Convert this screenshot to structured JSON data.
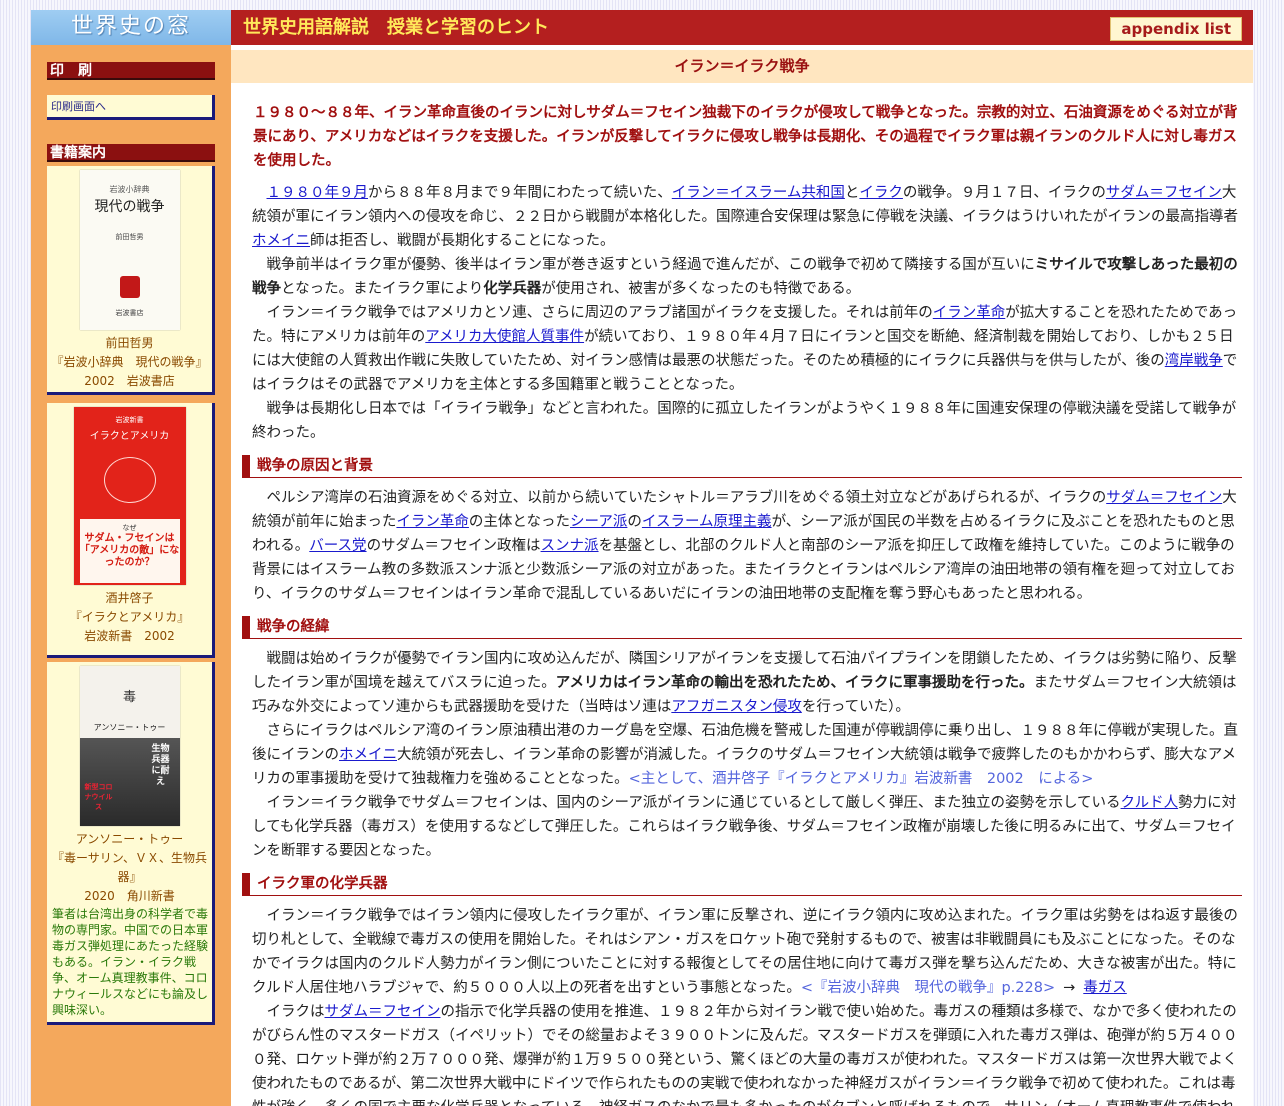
{
  "header": {
    "site_logo": "世界史の窓",
    "section_title": "世界史用語解説　授業と学習のヒント",
    "appendix_label": "appendix list"
  },
  "sidebar": {
    "print_heading": "印　刷",
    "print_link": "印刷画面へ",
    "books_heading": "書籍案内",
    "books": [
      {
        "cover_series": "岩波小辞典",
        "cover_title": "現代の戦争",
        "cover_author": "前田哲男",
        "cover_publisher": "岩波書店",
        "author": "前田哲男",
        "title": "『岩波小辞典　現代の戦争』",
        "pub": "2002　岩波書店"
      },
      {
        "cover_series": "岩波新書",
        "cover_title": "イラクとアメリカ",
        "cover_band_1": "なぜ",
        "cover_band_2": "サダム・フセインは「アメリカの敵」になったのか？",
        "author": "酒井啓子",
        "title": "『イラクとアメリカ』",
        "pub": "岩波新書　2002"
      },
      {
        "cover_title": "毒",
        "cover_author": "アンソニー・トゥー",
        "cover_big": "生物兵器に耐え",
        "cover_red": "新型コロナウイルス",
        "author": "アンソニー・トゥー",
        "title": "『毒ーサリン、ＶＸ、生物兵器』",
        "pub": "2020　角川新書",
        "desc": "筆者は台湾出身の科学者で毒物の専門家。中国での日本軍毒ガス弾処理にあたった経験もある。イラン・イラク戦争、オーム真理教事件、コロナウィールスなどにも論及し興味深い。"
      }
    ]
  },
  "main": {
    "term": "イラン＝イラク戦争",
    "lead": "１９８０～８８年、イラン革命直後のイランに対しサダム＝フセイン独裁下のイラクが侵攻して戦争となった。宗教的対立、石油資源をめぐる対立が背景にあり、アメリカなどはイラクを支援した。イランが反撃してイラクに侵攻し戦争は長期化、その過程でイラク軍は親イランのクルド人に対し毒ガスを使用した。",
    "p1": {
      "link_year": "１９８０年９月",
      "t1": "から８８年８月まで９年間にわたって続いた、",
      "link_iran": "イラン＝イスラーム共和国",
      "t2": "と",
      "link_iraq": "イラク",
      "t3": "の戦争。９月１７日、イラクの",
      "link_saddam": "サダム＝フセイン",
      "t4": "大統領が軍にイラン領内への侵攻を命じ、２２日から戦闘が本格化した。国際連合安保理は緊急に停戦を決議、イラクはうけいれたがイランの最高指導者",
      "link_khomeini": "ホメイニ",
      "t5": "師は拒否し、戦闘が長期化することになった。"
    },
    "p2": {
      "t1": "戦争前半はイラク軍が優勢、後半はイラン軍が巻き返すという経過で進んだが、この戦争で初めて隣接する国が互いに",
      "b1": "ミサイルで攻撃しあった最初の戦争",
      "t2": "となった。またイラク軍により",
      "b2": "化学兵器",
      "t3": "が使用され、被害が多くなったのも特徴である。"
    },
    "p3": {
      "t1": "イラン＝イラク戦争ではアメリカとソ連、さらに周辺のアラブ諸国がイラクを支援した。それは前年の",
      "link_rev": "イラン革命",
      "t2": "が拡大することを恐れたためであった。特にアメリカは前年の",
      "link_hostage": "アメリカ大使館人質事件",
      "t3": "が続いており、１９８０年４月７日にイランと国交を断絶、経済制裁を開始しており、しかも２５日には大使館の人質救出作戦に失敗していたため、対イラン感情は最悪の状態だった。そのため積極的にイラクに兵器供与を供与したが、後の",
      "link_gulf": "湾岸戦争",
      "t4": "ではイラクはその武器でアメリカを主体とする多国籍軍と戦うこととなった。"
    },
    "p4": "戦争は長期化し日本では「イライラ戦争」などと言われた。国際的に孤立したイランがようやく１９８８年に国連安保理の停戦決議を受諾して戦争が終わった。",
    "h_cause": "戦争の原因と背景",
    "p5": {
      "t1": "ペルシア湾岸の石油資源をめぐる対立、以前から続いていたシャトル＝アラブ川をめぐる領土対立などがあげられるが、イラクの",
      "link_saddam": "サダム＝フセイン",
      "t2": "大統領が前年に始まった",
      "link_rev": "イラン革命",
      "t3": "の主体となった",
      "link_shia": "シーア派",
      "t4": "の",
      "link_fund": "イスラーム原理主義",
      "t5": "が、シーア派が国民の半数を占めるイラクに及ぶことを恐れたものと思われる。",
      "link_baath": "バース党",
      "t6": "のサダム＝フセイン政権は",
      "link_sunni": "スンナ派",
      "t7": "を基盤とし、北部のクルド人と南部のシーア派を抑圧して政権を維持していた。このように戦争の背景にはイスラーム教の多数派スンナ派と少数派シーア派の対立があった。またイラクとイランはペルシア湾岸の油田地帯の領有権を廻って対立しており、イラクのサダム＝フセインはイラン革命で混乱しているあいだにイランの油田地帯の支配権を奪う野心もあったと思われる。"
    },
    "h_course": "戦争の経緯",
    "p6": {
      "t1": "戦闘は始めイラクが優勢でイラン国内に攻め込んだが、隣国シリアがイランを支援して石油パイプラインを閉鎖したため、イラクは劣勢に陥り、反撃したイラン軍が国境を越えてバスラに迫った。",
      "b1": "アメリカはイラン革命の輸出を恐れたため、イラクに軍事援助を行った。",
      "t2": "またサダム＝フセイン大統領は巧みな外交によってソ連からも武器援助を受けた（当時はソ連は",
      "link_afghan": "アフガニスタン侵攻",
      "t3": "を行っていた）。"
    },
    "p7": {
      "t1": "さらにイラクはペルシア湾のイラン原油積出港のカーグ島を空爆、石油危機を警戒した国連が停戦調停に乗り出し、１９８８年に停戦が実現した。直後にイランの",
      "link_khomeini": "ホメイニ",
      "t2": "大統領が死去し、イラン革命の影響が消滅した。イラクのサダム＝フセイン大統領は戦争で疲弊したのもかかわらず、膨大なアメリカの軍事援助を受けて独裁権力を強めることとなった。",
      "ref": "<主として、酒井啓子『イラクとアメリカ』岩波新書　2002　による>"
    },
    "p8": {
      "t1": "イラン＝イラク戦争でサダム＝フセインは、国内のシーア派がイランに通じているとして厳しく弾圧、また独立の姿勢を示している",
      "link_kurd": "クルド人",
      "t2": "勢力に対しても化学兵器（毒ガス）を使用するなどして弾圧した。これらはイラク戦争後、サダム＝フセイン政権が崩壊した後に明るみに出て、サダム＝フセインを断罪する要因となった。"
    },
    "h_chem": "イラク軍の化学兵器",
    "p9": {
      "t1": "イラン＝イラク戦争ではイラン領内に侵攻したイラク軍が、イラン軍に反撃され、逆にイラク領内に攻め込まれた。イラク軍は劣勢をはね返す最後の切り札として、全戦線で毒ガスの使用を開始した。それはシアン・ガスをロケット砲で発射するもので、被害は非戦闘員にも及ぶことになった。そのなかでイラクは国内のクルド人勢力がイラン側についたことに対する報復としてその居住地に向けて毒ガス弾を撃ち込んだため、大きな被害が出た。特にクルド人居住地ハラブジャで、約５０００人以上の死者を出すという事態となった。",
      "ref": "<『岩波小辞典　現代の戦争』p.228>",
      "arrow": "→",
      "link_gas": "毒ガス"
    },
    "p10": {
      "t1": "イラクは",
      "link_saddam": "サダム＝フセイン",
      "t2": "の指示で化学兵器の使用を推進、１９８２年から対イラン戦で使い始めた。毒ガスの種類は多様で、なかで多く使われたのがびらん性のマスタードガス（イペリット）でその総量およそ３９００トンに及んだ。マスタードガスを弾頭に入れた毒ガス弾は、砲弾が約５万４０００発、ロケット弾が約２万７０００発、爆弾が約１万９５００発という、驚くほどの大量の毒ガスが使われた。マスタードガスは第一次世界大戦でよく使われたものであるが、第二次世界大戦中にドイツで作られたものの実戦で使われなかった神経ガスがイラン＝イラク戦争で初めて使われた。これは毒性が強く、多くの国で主要な化学兵器となっている。神経ガスのなかで最も多かったのがタブンと呼ばれるもので、サリン（オーム真理教事件で使われた）とVXもそれに次いで使われた。"
    }
  }
}
